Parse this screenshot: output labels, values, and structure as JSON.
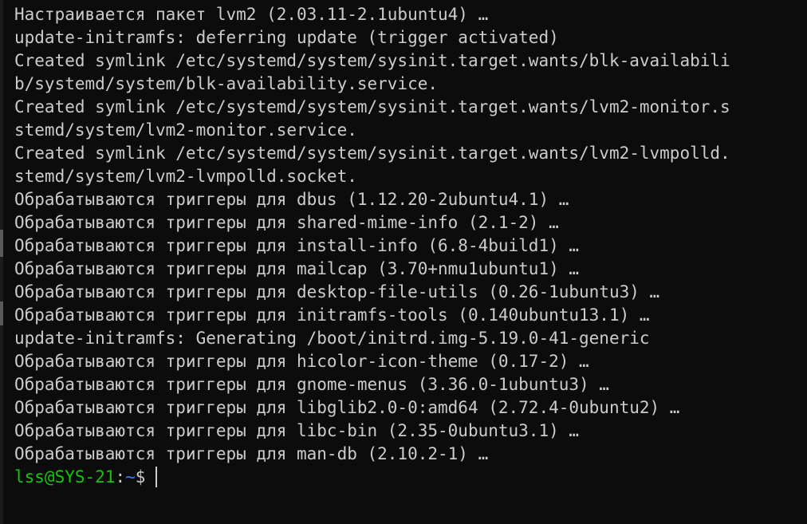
{
  "terminal": {
    "lines": [
      "Настраивается пакет lvm2 (2.03.11-2.1ubuntu4) …",
      "update-initramfs: deferring update (trigger activated)",
      "Created symlink /etc/systemd/system/sysinit.target.wants/blk-availabili",
      "b/systemd/system/blk-availability.service.",
      "Created symlink /etc/systemd/system/sysinit.target.wants/lvm2-monitor.s",
      "stemd/system/lvm2-monitor.service.",
      "Created symlink /etc/systemd/system/sysinit.target.wants/lvm2-lvmpolld.",
      "stemd/system/lvm2-lvmpolld.socket.",
      "Обрабатываются триггеры для dbus (1.12.20-2ubuntu4.1) …",
      "Обрабатываются триггеры для shared-mime-info (2.1-2) …",
      "Обрабатываются триггеры для install-info (6.8-4build1) …",
      "Обрабатываются триггеры для mailcap (3.70+nmu1ubuntu1) …",
      "Обрабатываются триггеры для desktop-file-utils (0.26-1ubuntu3) …",
      "Обрабатываются триггеры для initramfs-tools (0.140ubuntu13.1) …",
      "update-initramfs: Generating /boot/initrd.img-5.19.0-41-generic",
      "Обрабатываются триггеры для hicolor-icon-theme (0.17-2) …",
      "Обрабатываются триггеры для gnome-menus (3.36.0-1ubuntu3) …",
      "Обрабатываются триггеры для libglib2.0-0:amd64 (2.72.4-0ubuntu2) …",
      "Обрабатываются триггеры для libc-bin (2.35-0ubuntu3.1) …",
      "Обрабатываются триггеры для man-db (2.10.2-1) …"
    ],
    "prompt": {
      "user_host": "lss@SYS-21",
      "separator": ":",
      "path": "~",
      "symbol": "$"
    }
  },
  "colors": {
    "background": "#0c0c0c",
    "text": "#cccccc",
    "prompt_user": "#16c60c",
    "prompt_path": "#3b78ff"
  }
}
